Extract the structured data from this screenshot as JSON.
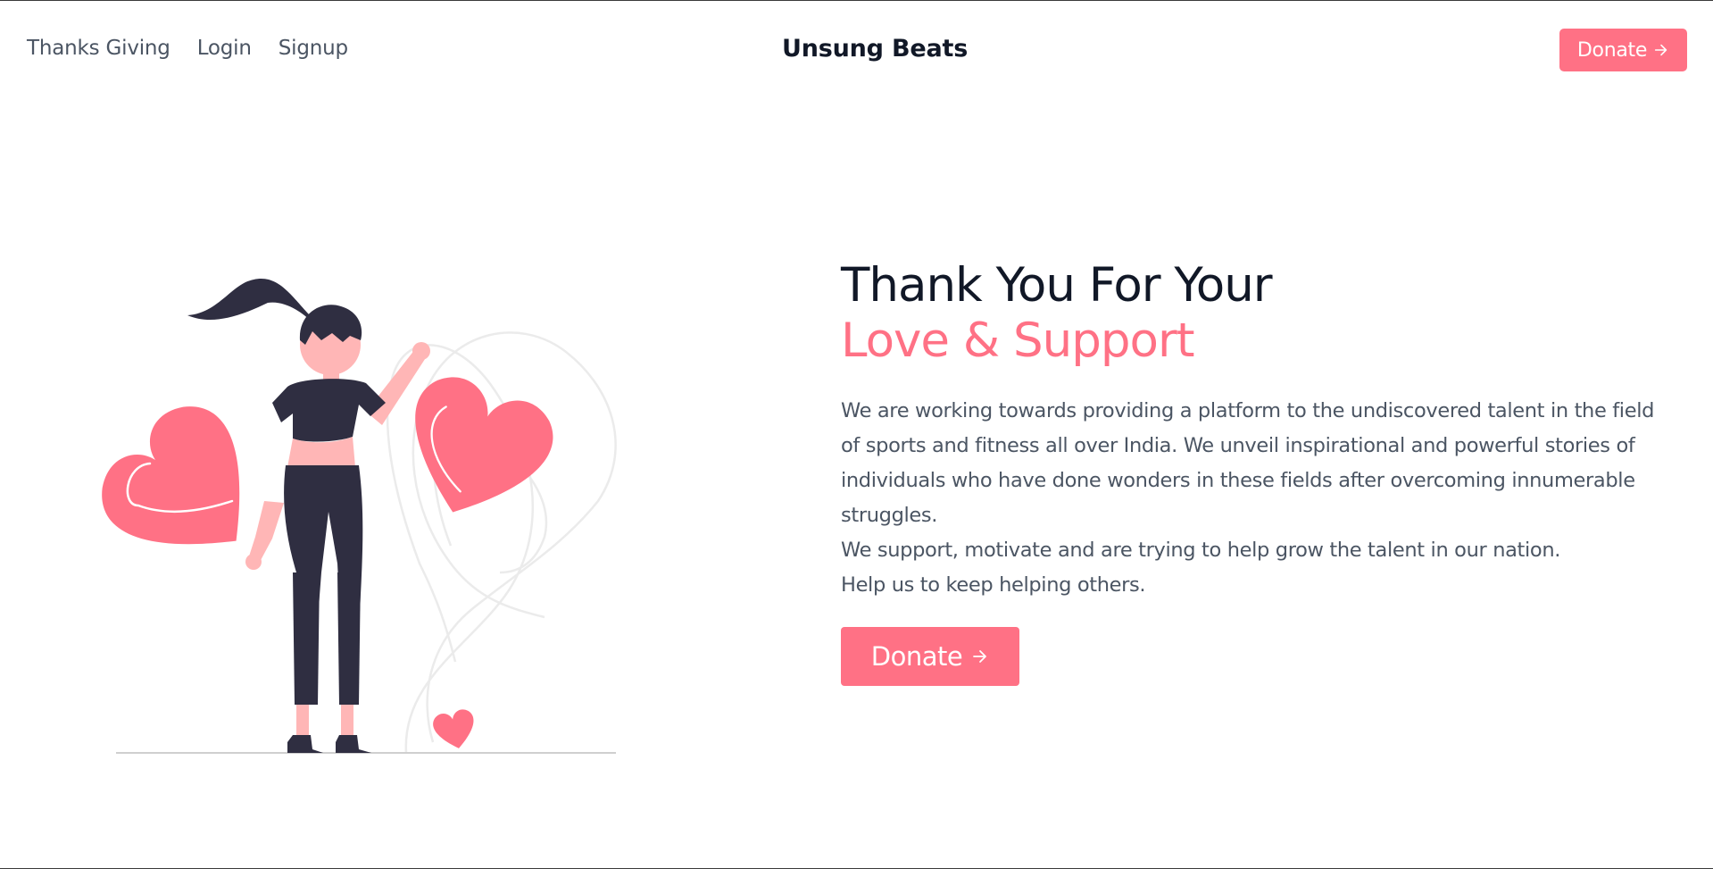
{
  "nav": {
    "links": [
      "Thanks Giving",
      "Login",
      "Signup"
    ],
    "brand": "Unsung Beats",
    "donate_label": "Donate"
  },
  "hero": {
    "title_line1": "Thank You For Your",
    "title_line2": "Love & Support",
    "paragraphs": [
      "We are working towards providing a platform to the undiscovered talent in the field of sports and fitness all over India. We unveil inspirational and powerful stories of individuals who have done wonders in these fields after overcoming innumerable struggles.",
      "We support, motivate and are trying to help grow the talent in our nation.",
      "Help us to keep helping others."
    ],
    "donate_label": "Donate"
  },
  "colors": {
    "accent": "#ff7185",
    "heading": "#111827",
    "body_text": "#4b5563",
    "figure_dark": "#2f2e41",
    "skin": "#ffb6b6"
  },
  "icons": {
    "arrow": "arrow-right-icon",
    "illustration": "woman-holding-hearts-illustration"
  }
}
